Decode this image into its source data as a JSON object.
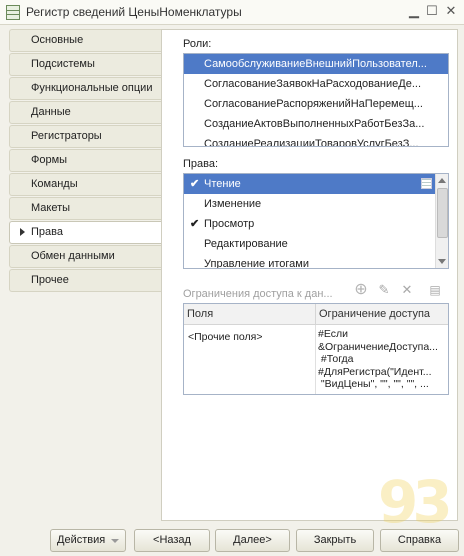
{
  "window": {
    "title": "Регистр сведений ЦеныНоменклатуры"
  },
  "tabs": [
    {
      "label": "Основные",
      "active": false
    },
    {
      "label": "Подсистемы",
      "active": false
    },
    {
      "label": "Функциональные опции",
      "active": false
    },
    {
      "label": "Данные",
      "active": false
    },
    {
      "label": "Регистраторы",
      "active": false
    },
    {
      "label": "Формы",
      "active": false
    },
    {
      "label": "Команды",
      "active": false
    },
    {
      "label": "Макеты",
      "active": false
    },
    {
      "label": "Права",
      "active": true
    },
    {
      "label": "Обмен данными",
      "active": false
    },
    {
      "label": "Прочее",
      "active": false
    }
  ],
  "roles": {
    "label": "Роли:",
    "items": [
      "СамообслуживаниеВнешнийПользовател...",
      "СогласованиеЗаявокНаРасходованиеДе...",
      "СогласованиеРаспоряженийНаПеремещ...",
      "СозданиеАктовВыполненныхРаботБезЗа...",
      "СозданиеРеализацииТоваровУслугБезЗ..."
    ],
    "selected_index": 0
  },
  "rights": {
    "label": "Права:",
    "items": [
      {
        "label": "Чтение",
        "checked": true
      },
      {
        "label": "Изменение",
        "checked": false
      },
      {
        "label": "Просмотр",
        "checked": true
      },
      {
        "label": "Редактирование",
        "checked": false
      },
      {
        "label": "Управление итогами",
        "checked": false
      }
    ],
    "selected_index": 0
  },
  "restrictions": {
    "label": "Ограничения доступа к дан...",
    "columns": [
      "Поля",
      "Ограничение доступа"
    ],
    "row": {
      "field": "<Прочие поля>",
      "condition": "#Если\n&ОграничениеДоступа...\n #Тогда\n#ДляРегистра(\"Идент...\n \"ВидЦены\", \"\", \"\", \"\", ..."
    }
  },
  "buttons": {
    "actions": "Действия",
    "back": "<Назад",
    "next": "Далее>",
    "close": "Закрыть",
    "help": "Справка"
  },
  "watermark": "93"
}
